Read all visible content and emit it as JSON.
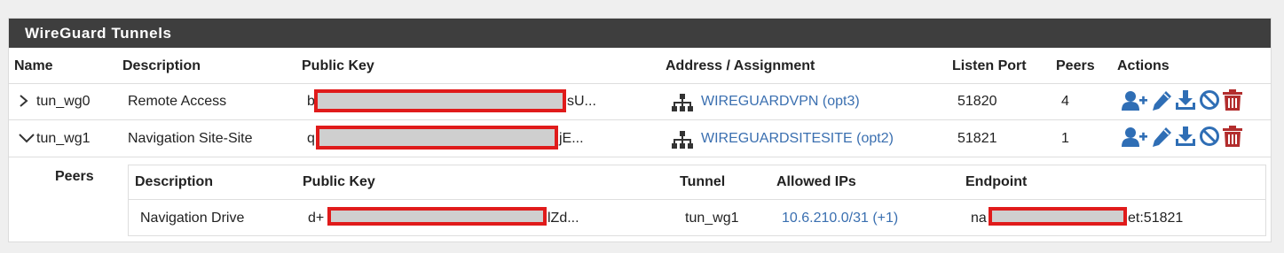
{
  "panel": {
    "title": "WireGuard Tunnels"
  },
  "tunnels_table": {
    "headers": {
      "name": "Name",
      "description": "Description",
      "public_key": "Public Key",
      "address": "Address / Assignment",
      "listen_port": "Listen Port",
      "peers": "Peers",
      "actions": "Actions"
    },
    "rows": [
      {
        "name": "tun_wg0",
        "expanded": false,
        "description": "Remote Access",
        "key_prefix": "b",
        "key_suffix": "sU...",
        "assignment": "WIREGUARDVPN (opt3)",
        "listen_port": "51820",
        "peers": "4"
      },
      {
        "name": "tun_wg1",
        "expanded": true,
        "description": "Navigation Site-Site",
        "key_prefix": "q",
        "key_suffix": "jE...",
        "assignment": "WIREGUARDSITESITE (opt2)",
        "listen_port": "51821",
        "peers": "1"
      }
    ]
  },
  "peers_section": {
    "label": "Peers",
    "headers": {
      "description": "Description",
      "public_key": "Public Key",
      "tunnel": "Tunnel",
      "allowed_ips": "Allowed IPs",
      "endpoint": "Endpoint"
    },
    "rows": [
      {
        "description": "Navigation Drive",
        "key_prefix": "d+",
        "key_suffix": "lZd...",
        "tunnel": "tun_wg1",
        "allowed_ips": "10.6.210.0/31 (+1)",
        "endpoint_prefix": "na",
        "endpoint_suffix": "et:51821"
      }
    ]
  },
  "icons": {
    "interface": "sitemap-icon",
    "add_peer": "user-plus-icon",
    "edit": "pencil-icon",
    "download": "download-icon",
    "disable": "ban-icon",
    "delete": "trash-icon"
  },
  "colors": {
    "header_bg": "#3e3e3e",
    "link": "#3a6fb0",
    "action_blue": "#2f6eb5",
    "delete_red": "#b22d2d",
    "redaction_border": "#e01b1b"
  }
}
